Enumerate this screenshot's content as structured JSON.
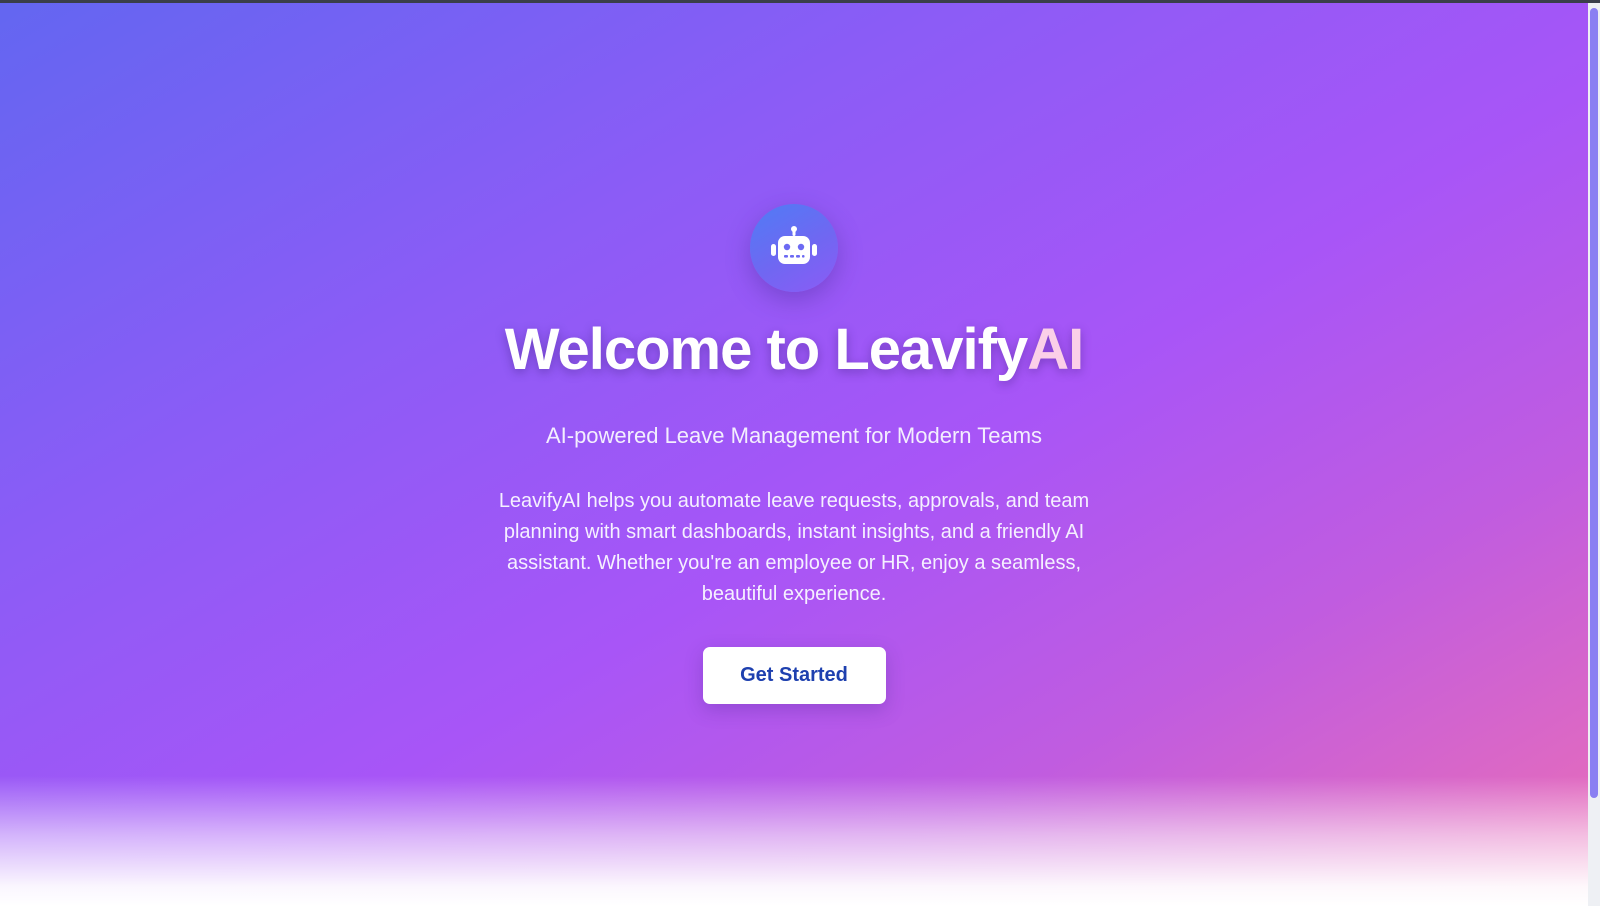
{
  "hero": {
    "logo_icon": "robot-icon",
    "title_main": "Welcome to Leavify",
    "title_accent": "AI",
    "subtitle": "AI-powered Leave Management for Modern Teams",
    "description": "LeavifyAI helps you automate leave requests, approvals, and team planning with smart dashboards, instant insights, and a friendly AI assistant. Whether you're an employee or HR, enjoy a seamless, beautiful experience.",
    "cta_label": "Get Started"
  },
  "colors": {
    "gradient_start": "#6366f1",
    "gradient_mid": "#a855f7",
    "gradient_end": "#ec6fb5",
    "title_accent": "#fbcfe8",
    "cta_text": "#1e40af"
  }
}
